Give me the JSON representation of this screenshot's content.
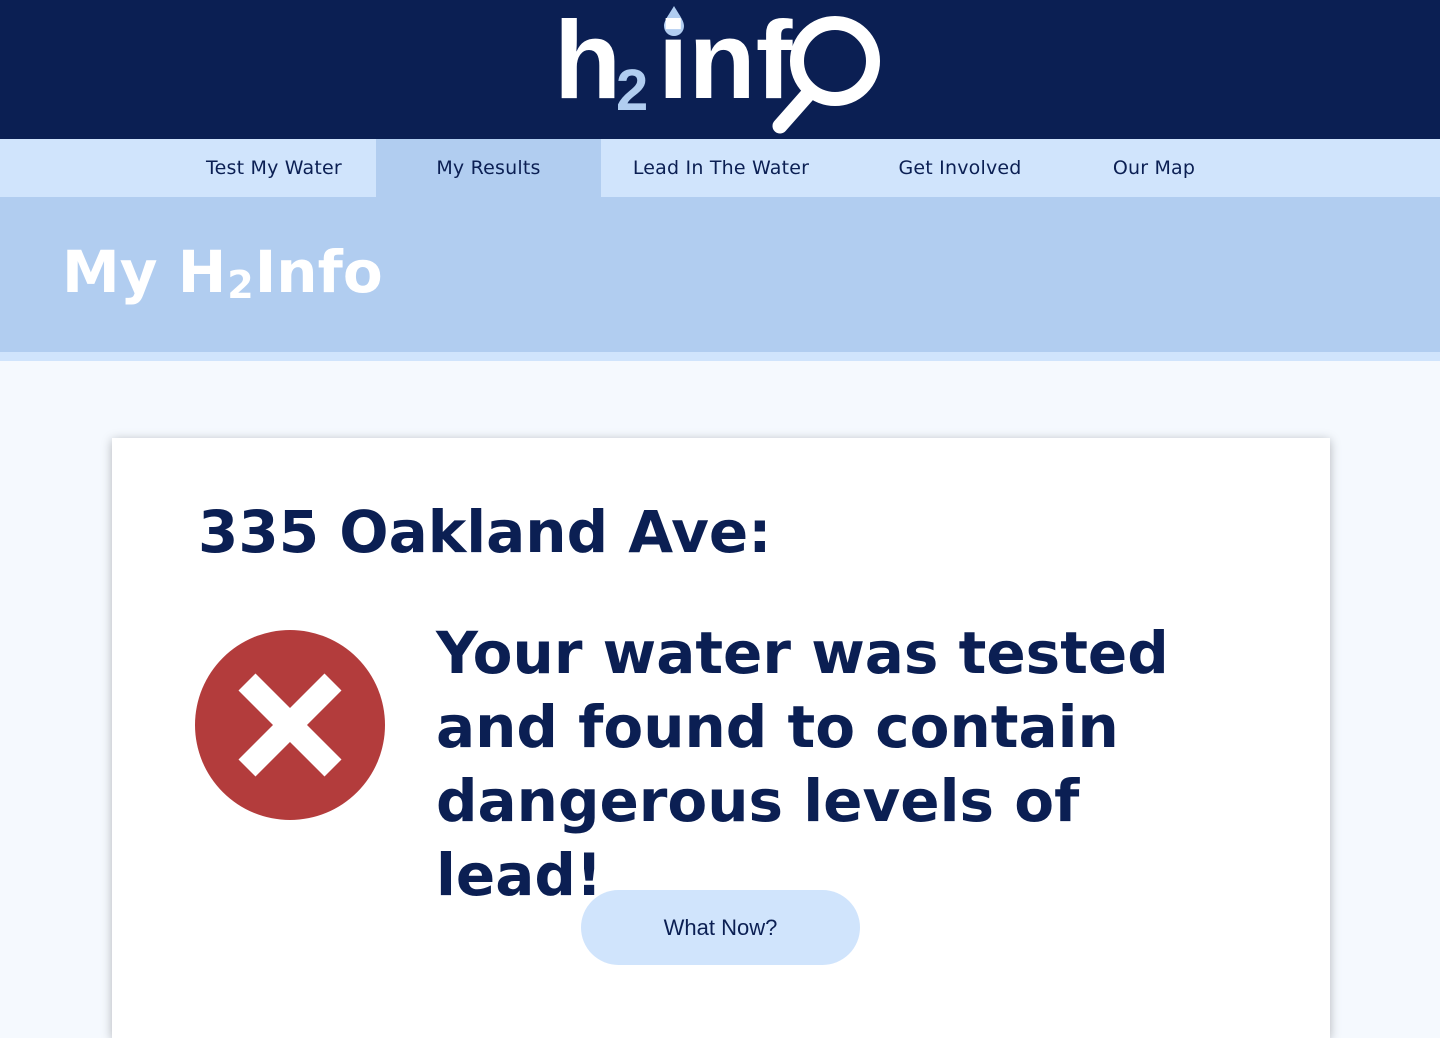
{
  "brand": {
    "logo_letters": [
      "h",
      "2",
      "inf",
      "O"
    ],
    "colors": {
      "header_bg": "#0b1f53",
      "nav_bg": "#d0e4fc",
      "nav_active_bg": "#b1cdf0",
      "banner_bg": "#b1cdf0",
      "logo_accent": "#b1cdf0",
      "alert_red": "#b33c3c"
    }
  },
  "nav": {
    "items": [
      {
        "label": "Test My Water",
        "active": false
      },
      {
        "label": "My Results",
        "active": true
      },
      {
        "label": "Lead In The Water",
        "active": false
      },
      {
        "label": "Get Involved",
        "active": false
      },
      {
        "label": "Our Map",
        "active": false
      }
    ]
  },
  "banner": {
    "title_prefix": "My H",
    "title_sub": "2",
    "title_suffix": "Info"
  },
  "result": {
    "address": "335 Oakland Ave:",
    "status_icon": "error-x-icon",
    "message": "Your water was tested and found to contain dangerous levels of lead!",
    "cta_label": "What Now?"
  }
}
